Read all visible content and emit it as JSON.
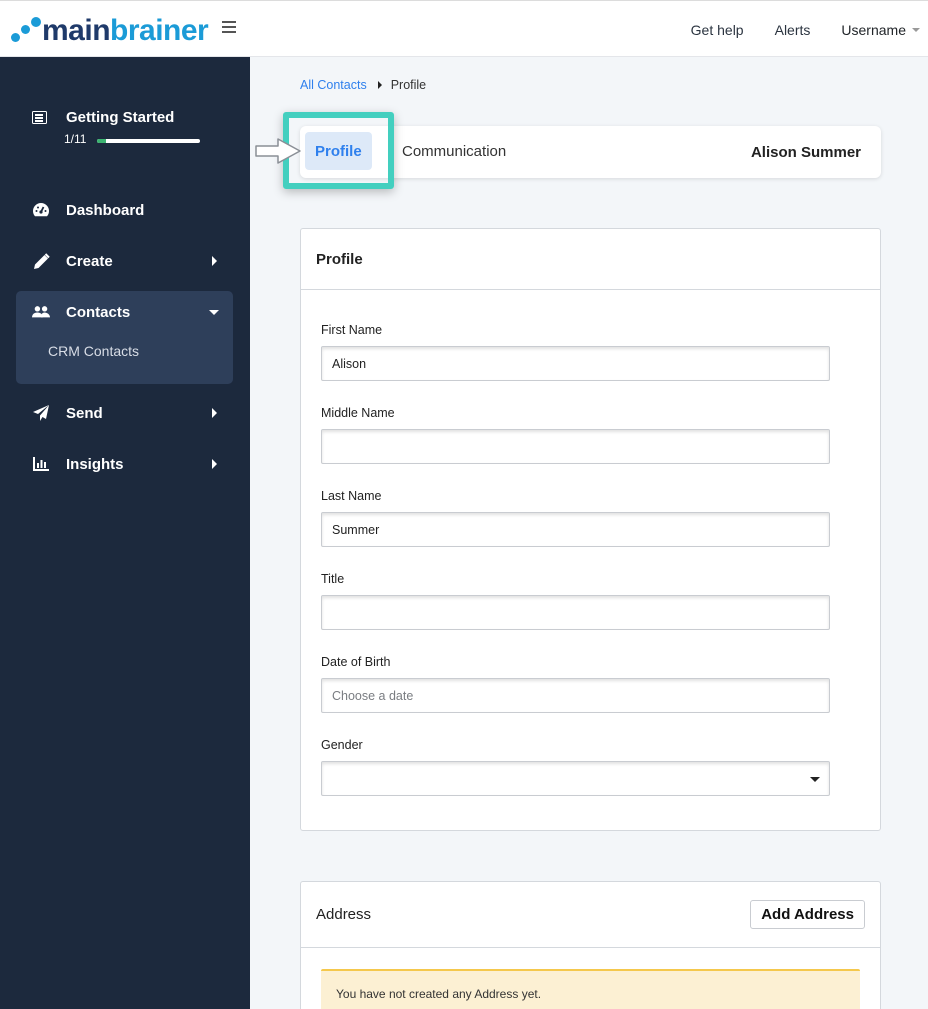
{
  "brand": {
    "part1": "main",
    "part2": "brainer",
    "primary_color": "#1f3a6a",
    "accent_color": "#1b9bd7"
  },
  "topnav": {
    "help": "Get help",
    "alerts": "Alerts",
    "user": "Username"
  },
  "sidebar": {
    "getting_started": {
      "title": "Getting Started",
      "count": "1/11",
      "progress": 0.09
    },
    "items": [
      {
        "label": "Dashboard",
        "icon": "dashboard-icon"
      },
      {
        "label": "Create",
        "icon": "pencil-icon"
      },
      {
        "label": "Contacts",
        "icon": "users-icon",
        "expanded": true,
        "children": [
          {
            "label": "CRM Contacts"
          }
        ]
      },
      {
        "label": "Send",
        "icon": "paper-plane-icon"
      },
      {
        "label": "Insights",
        "icon": "bar-chart-icon"
      }
    ]
  },
  "breadcrumb": {
    "parent": "All Contacts",
    "current": "Profile"
  },
  "tabs": [
    {
      "label": "Profile",
      "active": true
    },
    {
      "label": "Communication",
      "active": false
    }
  ],
  "contact_name": "Alison Summer",
  "profile_panel": {
    "title": "Profile",
    "fields": [
      {
        "label": "First Name",
        "value": "Alison"
      },
      {
        "label": "Middle Name",
        "value": ""
      },
      {
        "label": "Last Name",
        "value": "Summer"
      },
      {
        "label": "Title",
        "value": ""
      },
      {
        "label": "Date of Birth",
        "value": "",
        "placeholder": "Choose a date"
      },
      {
        "label": "Gender",
        "value": "",
        "type": "select"
      }
    ]
  },
  "address_panel": {
    "title": "Address",
    "add_button": "Add Address",
    "empty_message": "You have not created any Address yet."
  },
  "highlight_color": "#43cfbf"
}
